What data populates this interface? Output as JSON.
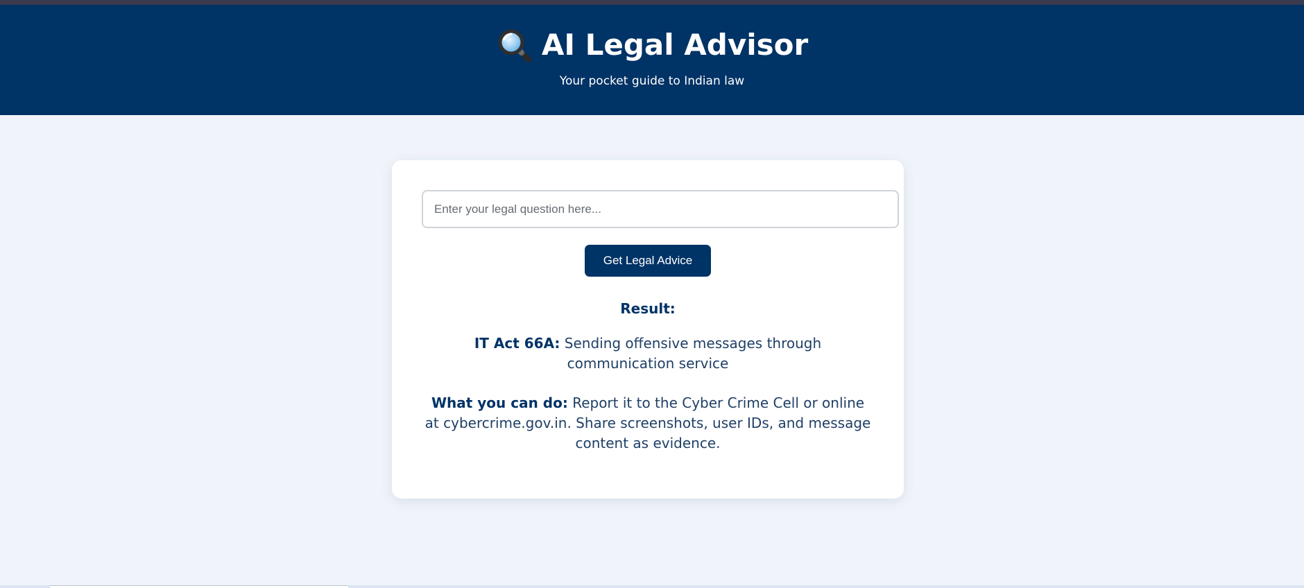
{
  "header": {
    "title": "AI Legal Advisor",
    "title_icon": "magnifying-glass-icon",
    "subtitle": "Your pocket guide to Indian law"
  },
  "query": {
    "placeholder": "Enter your legal question here...",
    "value": ""
  },
  "actions": {
    "submit_label": "Get Legal Advice"
  },
  "result": {
    "heading": "Result:",
    "law_label": "IT Act 66A:",
    "law_text": " Sending offensive messages through communication service",
    "action_label": "What you can do:",
    "action_text": " Report it to the Cyber Crime Cell or online at cybercrime.gov.in. Share screenshots, user IDs, and message content as evidence."
  },
  "colors": {
    "brand": "#003366",
    "background": "#f0f4fa",
    "card": "#ffffff"
  }
}
